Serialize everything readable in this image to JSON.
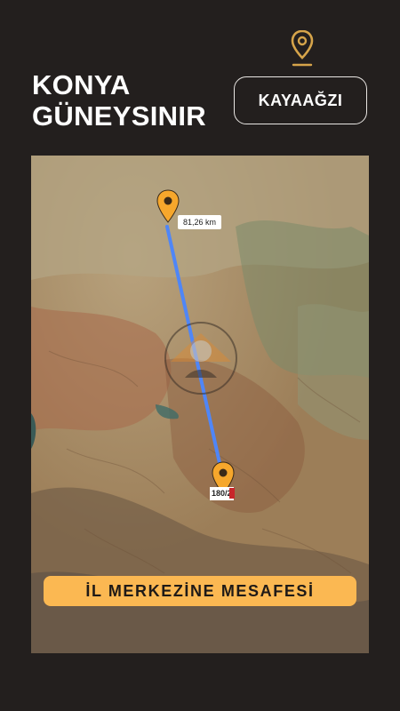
{
  "header": {
    "title_line1": "KONYA",
    "title_line2": "GÜNEYSINIR",
    "location_button": "KAYAAĞZI",
    "location_icon": "map-pin-icon"
  },
  "map": {
    "distance_label": "81,26 km",
    "parcel_label": "180/2",
    "banner_text": "İL MERKEZİNE MESAFESİ",
    "route_color": "#4f86f7",
    "pin_color": "#f6a72c",
    "banner_color": "#fbb852"
  }
}
